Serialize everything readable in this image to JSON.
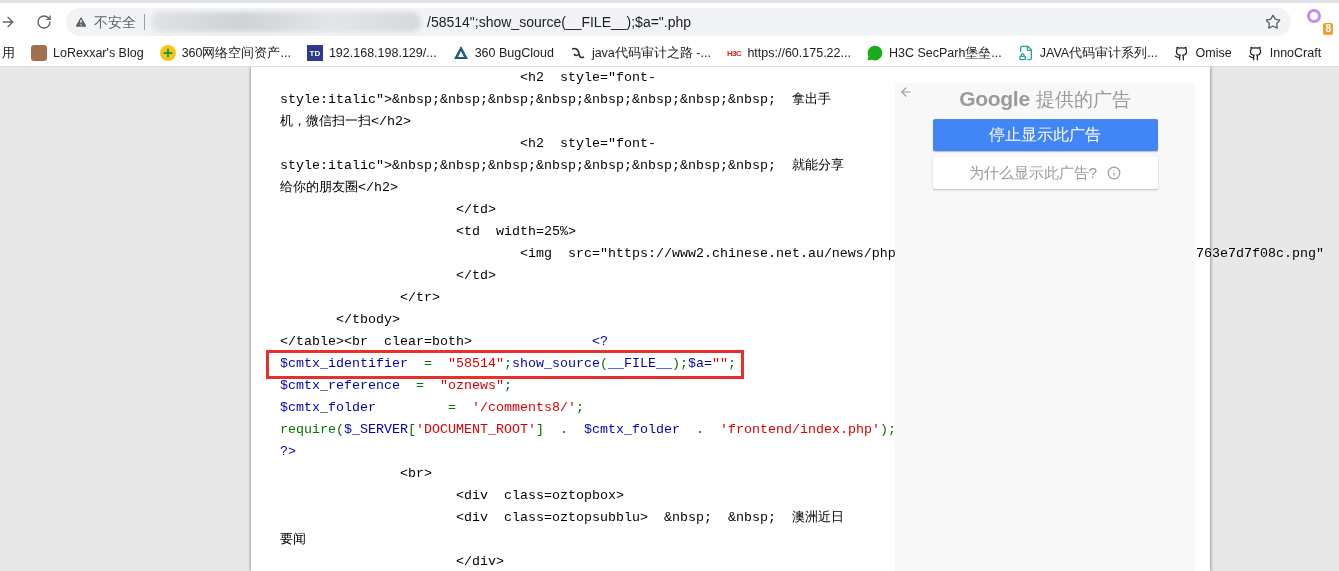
{
  "browser": {
    "security_label": "不安全",
    "url_visible": "/58514\";show_source(__FILE__);$a=\".php",
    "extension_badge": "8"
  },
  "bookmarks": [
    {
      "label": "用",
      "kind": "plain"
    },
    {
      "label": "LoRexxar's Blog",
      "kind": "person"
    },
    {
      "label": "360网络空间资产...",
      "kind": "plus"
    },
    {
      "label": "192.168.198.129/...",
      "kind": "tile",
      "icon_text": "TD"
    },
    {
      "label": "360 BugCloud",
      "kind": "triangle"
    },
    {
      "label": "java代码审计之路 -...",
      "kind": "swirl"
    },
    {
      "label": "https://60.175.22...",
      "kind": "brand",
      "icon_text": "H3C"
    },
    {
      "label": "H3C SecParh堡垒...",
      "kind": "chat"
    },
    {
      "label": "JAVA代码审计系列...",
      "kind": "doc"
    },
    {
      "label": "Omise",
      "kind": "github"
    },
    {
      "label": "InnoCraft",
      "kind": "github"
    }
  ],
  "code_lines": [
    {
      "highlighted": false,
      "tokens": [
        {
          "text": "                              <h2  style=\"font-",
          "kind": "plain"
        }
      ]
    },
    {
      "highlighted": false,
      "tokens": [
        {
          "text": "style:italic\">&nbsp;&nbsp;&nbsp;&nbsp;&nbsp;&nbsp;&nbsp;&nbsp;  拿出手",
          "kind": "plain"
        }
      ]
    },
    {
      "highlighted": false,
      "tokens": [
        {
          "text": "机，微信扫一扫</h2>",
          "kind": "plain"
        }
      ]
    },
    {
      "highlighted": false,
      "tokens": [
        {
          "text": "                              <h2  style=\"font-",
          "kind": "plain"
        }
      ]
    },
    {
      "highlighted": false,
      "tokens": [
        {
          "text": "style:italic\">&nbsp;&nbsp;&nbsp;&nbsp;&nbsp;&nbsp;&nbsp;&nbsp;  就能分享",
          "kind": "plain"
        }
      ]
    },
    {
      "highlighted": false,
      "tokens": [
        {
          "text": "给你的朋友圈</h2>",
          "kind": "plain"
        }
      ]
    },
    {
      "highlighted": false,
      "tokens": [
        {
          "text": "                      </td>",
          "kind": "plain"
        }
      ]
    },
    {
      "highlighted": false,
      "tokens": [
        {
          "text": "                      <td  width=25%>",
          "kind": "plain"
        }
      ]
    },
    {
      "highlighted": false,
      "tokens": [
        {
          "text": "                              <img  src=\"https://www2.chinese.net.au/news/php",
          "kind": "plain"
        }
      ],
      "tail": "763e7d7f08c.png\""
    },
    {
      "highlighted": false,
      "tokens": [
        {
          "text": "                      </td>",
          "kind": "plain"
        }
      ]
    },
    {
      "highlighted": false,
      "tokens": [
        {
          "text": "               </tr>",
          "kind": "plain"
        }
      ]
    },
    {
      "highlighted": false,
      "tokens": [
        {
          "text": "       </tbody>",
          "kind": "plain"
        }
      ]
    },
    {
      "highlighted": false,
      "tokens": [
        {
          "text": "</table><br  clear=both>",
          "kind": "plain"
        },
        {
          "text": "               <?",
          "kind": "keyword"
        }
      ]
    },
    {
      "highlighted": true,
      "tokens": [
        {
          "text": "$cmtx_identifier",
          "kind": "keyword"
        },
        {
          "text": "  =  ",
          "kind": "operator"
        },
        {
          "text": "\"58514\"",
          "kind": "string"
        },
        {
          "text": ";",
          "kind": "operator"
        },
        {
          "text": "show_source",
          "kind": "keyword"
        },
        {
          "text": "(",
          "kind": "operator"
        },
        {
          "text": "__FILE__",
          "kind": "keyword"
        },
        {
          "text": ")",
          "kind": "operator"
        },
        {
          "text": ";",
          "kind": "operator"
        },
        {
          "text": "$a=",
          "kind": "keyword"
        },
        {
          "text": "\"\"",
          "kind": "string"
        },
        {
          "text": ";",
          "kind": "operator"
        }
      ]
    },
    {
      "highlighted": false,
      "tokens": [
        {
          "text": "$cmtx_reference",
          "kind": "keyword"
        },
        {
          "text": "  =  ",
          "kind": "operator"
        },
        {
          "text": "\"oznews\"",
          "kind": "string"
        },
        {
          "text": ";",
          "kind": "operator"
        }
      ]
    },
    {
      "highlighted": false,
      "tokens": [
        {
          "text": "$cmtx_folder",
          "kind": "keyword"
        },
        {
          "text": "         =  ",
          "kind": "operator"
        },
        {
          "text": "'/comments8/'",
          "kind": "string"
        },
        {
          "text": ";",
          "kind": "operator"
        }
      ]
    },
    {
      "highlighted": false,
      "tokens": [
        {
          "text": "require(",
          "kind": "operator"
        },
        {
          "text": "$_SERVER",
          "kind": "keyword"
        },
        {
          "text": "[",
          "kind": "operator"
        },
        {
          "text": "'DOCUMENT_ROOT'",
          "kind": "string"
        },
        {
          "text": "]  .  ",
          "kind": "operator"
        },
        {
          "text": "$cmtx_folder",
          "kind": "keyword"
        },
        {
          "text": "  .  ",
          "kind": "operator"
        },
        {
          "text": "'frontend/index.php'",
          "kind": "string"
        },
        {
          "text": ");",
          "kind": "operator"
        }
      ]
    },
    {
      "highlighted": false,
      "tokens": [
        {
          "text": "?>",
          "kind": "keyword"
        }
      ]
    },
    {
      "highlighted": false,
      "tokens": [
        {
          "text": "               <br>",
          "kind": "plain"
        }
      ]
    },
    {
      "highlighted": false,
      "tokens": [
        {
          "text": "                      <div  class=oztopbox>",
          "kind": "plain"
        }
      ]
    },
    {
      "highlighted": false,
      "tokens": [
        {
          "text": "                      <div  class=oztopsubblu>  &nbsp;  &nbsp;  澳洲近日",
          "kind": "plain"
        }
      ]
    },
    {
      "highlighted": false,
      "tokens": [
        {
          "text": "要闻",
          "kind": "plain"
        }
      ]
    },
    {
      "highlighted": false,
      "tokens": [
        {
          "text": "                      </div>",
          "kind": "plain"
        }
      ]
    }
  ],
  "ad_panel": {
    "logo": "Google",
    "title": "提供的广告",
    "stop_button": "停止显示此广告",
    "why_button": "为什么显示此广告?"
  }
}
